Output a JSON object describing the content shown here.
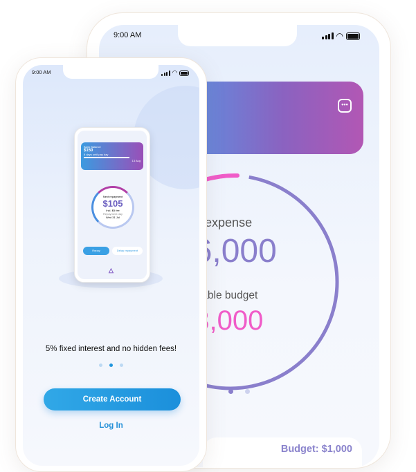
{
  "back_phone": {
    "status_time": "9:00 AM",
    "total_expense_label": "Total expense",
    "total_expense_value": "$6,000",
    "available_budget_label": "Available budget",
    "available_budget_value": "$3,000",
    "budget_label": "Budget: $1,000",
    "more_icon": "more-horizontal-icon",
    "colors": {
      "purple": "#8a7fcc",
      "pink": "#f05cc8",
      "card_start": "#5f8ee0",
      "card_end": "#b257b4"
    }
  },
  "front_phone": {
    "status_time": "9:00 AM",
    "mini_app": {
      "bank_balance_label": "Bank Balance",
      "bank_balance_value": "$150",
      "payday_text": "8 days until pay day",
      "payday_date": "13 Aug",
      "next_repayment_label": "Next repayment",
      "next_repayment_value": "$105",
      "fee_text": "Incl. $5 fee",
      "repayment_day_label": "Repayment day",
      "repayment_day_value": "Wed 31 Jul",
      "repay_button": "Repay",
      "delay_button": "Delay repayment"
    },
    "tagline": "5% fixed interest and no hidden fees!",
    "pager": {
      "pages": 3,
      "active": 1
    },
    "create_account_button": "Create Account",
    "login_link": "Log In",
    "colors": {
      "accent": "#1f95dd"
    }
  }
}
